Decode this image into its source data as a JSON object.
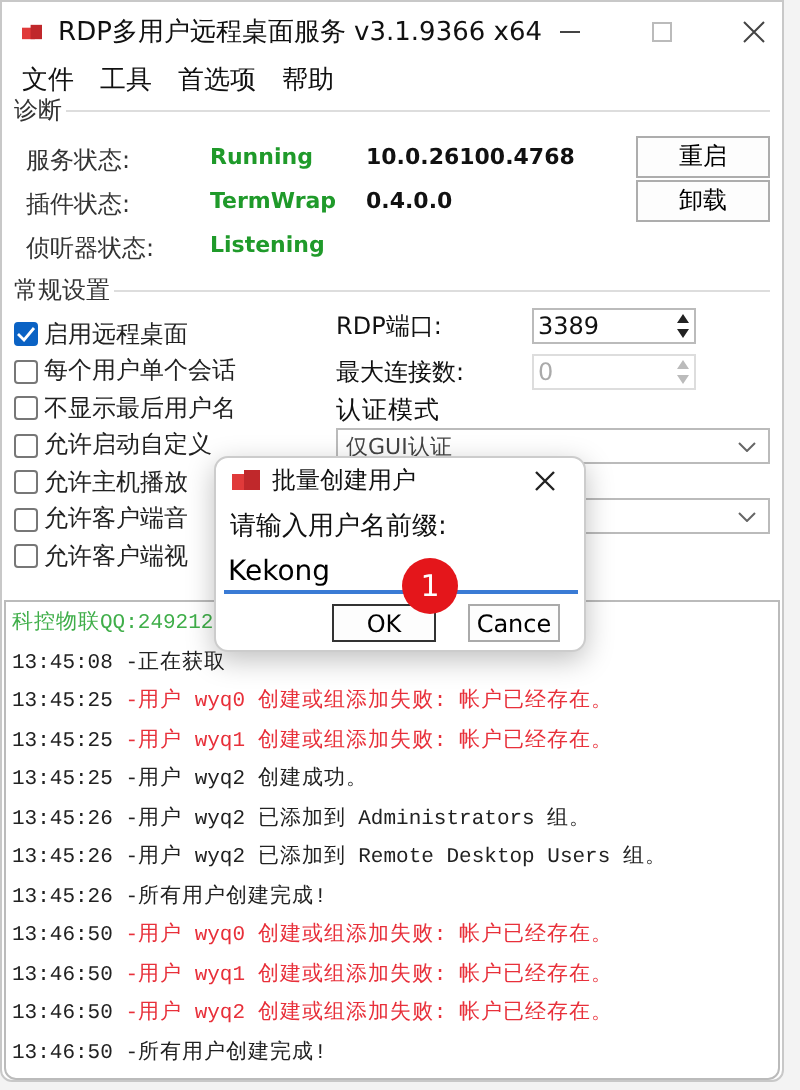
{
  "window": {
    "title": "RDP多用户远程桌面服务 v3.1.9366 x64"
  },
  "menu": [
    "文件",
    "工具",
    "首选项",
    "帮助"
  ],
  "diagnostics": {
    "title": "诊断",
    "rows": [
      {
        "label": "服务状态:",
        "value": "Running",
        "version": "10.0.26100.4768"
      },
      {
        "label": "插件状态:",
        "value": "TermWrap",
        "version": "0.4.0.0"
      },
      {
        "label": "侦听器状态:",
        "value": "Listening"
      }
    ],
    "buttons": [
      "重启",
      "卸载"
    ]
  },
  "settings": {
    "title": "常规设置",
    "checkboxes": [
      {
        "label": "启用远程桌面",
        "checked": true
      },
      {
        "label": "每个用户单个会话",
        "checked": false
      },
      {
        "label": "不显示最后用户名",
        "checked": false
      },
      {
        "label": "允许启动自定义",
        "checked": false
      },
      {
        "label": "允许主机播放",
        "checked": false
      },
      {
        "label": "允许客户端音",
        "checked": false
      },
      {
        "label": "允许客户端视",
        "checked": false
      }
    ],
    "port": {
      "label": "RDP端口:",
      "value": "3389",
      "disabled": false
    },
    "max_connections": {
      "label": "最大连接数:",
      "value": "0",
      "disabled": true
    },
    "auth": {
      "label": "认证模式",
      "value": "仅GUI认证"
    }
  },
  "log": [
    {
      "kind": "note",
      "text": "科控物联QQ:249212"
    },
    {
      "kind": "info",
      "time": "13:45:08",
      "text": "-正在获取"
    },
    {
      "kind": "error",
      "time": "13:45:25",
      "text": "-用户 wyq0 创建或组添加失败: 帐户已经存在。"
    },
    {
      "kind": "error",
      "time": "13:45:25",
      "text": "-用户 wyq1 创建或组添加失败: 帐户已经存在。"
    },
    {
      "kind": "info",
      "time": "13:45:25",
      "text": "-用户 wyq2 创建成功。"
    },
    {
      "kind": "info",
      "time": "13:45:26",
      "text": "-用户 wyq2 已添加到 Administrators 组。"
    },
    {
      "kind": "info",
      "time": "13:45:26",
      "text": "-用户 wyq2 已添加到 Remote Desktop Users 组。"
    },
    {
      "kind": "info",
      "time": "13:45:26",
      "text": "-所有用户创建完成!"
    },
    {
      "kind": "error",
      "time": "13:46:50",
      "text": "-用户 wyq0 创建或组添加失败: 帐户已经存在。"
    },
    {
      "kind": "error",
      "time": "13:46:50",
      "text": "-用户 wyq1 创建或组添加失败: 帐户已经存在。"
    },
    {
      "kind": "error",
      "time": "13:46:50",
      "text": "-用户 wyq2 创建或组添加失败: 帐户已经存在。"
    },
    {
      "kind": "info",
      "time": "13:46:50",
      "text": "-所有用户创建完成!"
    }
  ],
  "dialog": {
    "title": "批量创建用户",
    "prompt": "请输入用户名前缀:",
    "value": "Kekong",
    "buttons": [
      "OK",
      "Cance"
    ]
  },
  "badge": "1"
}
